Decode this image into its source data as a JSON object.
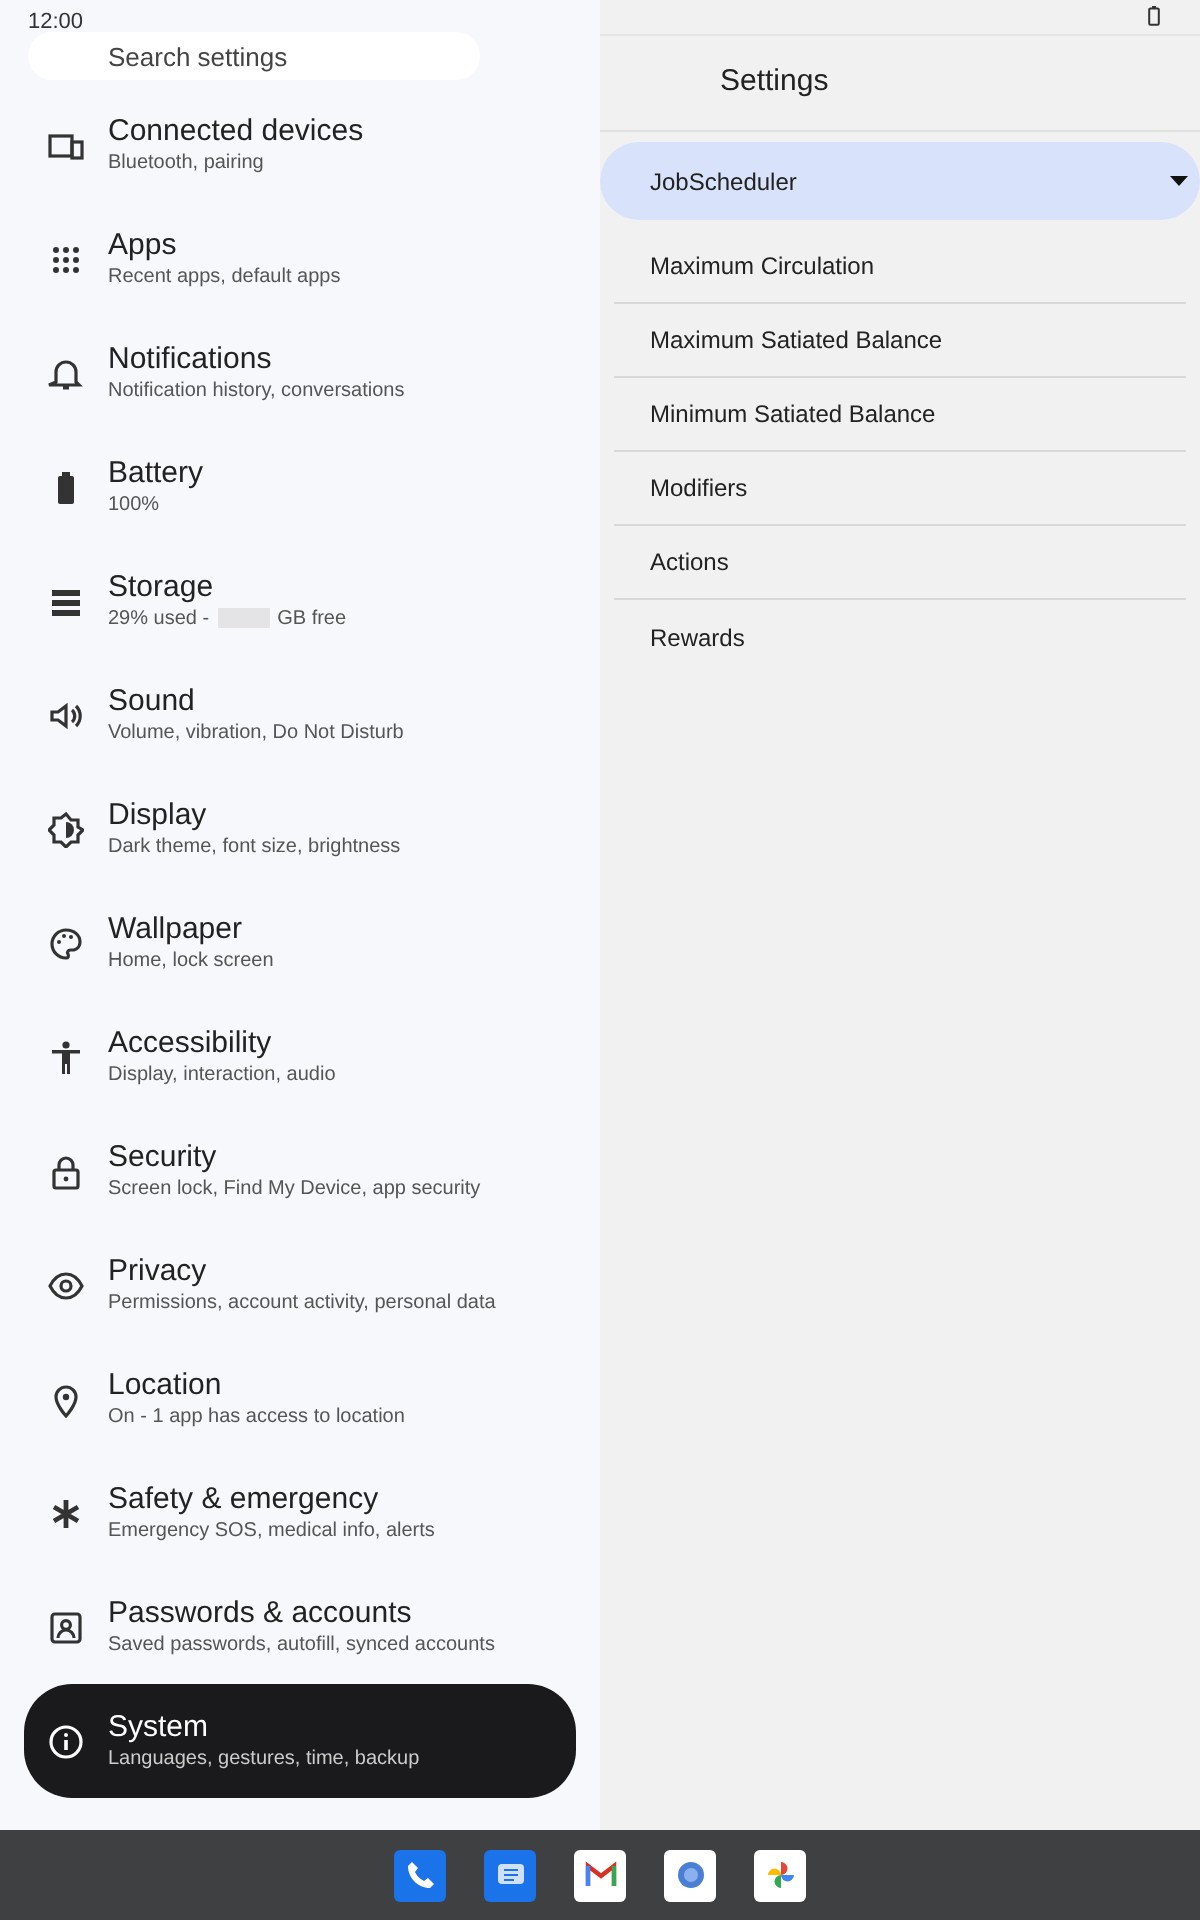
{
  "status_bar": {
    "time": "12:00"
  },
  "search": {
    "placeholder": "Search settings"
  },
  "sidebar": {
    "items": [
      {
        "title": "Connected devices",
        "subtitle": "Bluetooth, pairing",
        "selected": false
      },
      {
        "title": "Apps",
        "subtitle": "Recent apps, default apps",
        "selected": false
      },
      {
        "title": "Notifications",
        "subtitle": "Notification history, conversations",
        "selected": false
      },
      {
        "title": "Battery",
        "subtitle": "100%",
        "selected": false
      },
      {
        "title": "Storage",
        "subtitle": "29% used -",
        "redacted": true,
        "subtitle_end": "GB free",
        "selected": false
      },
      {
        "title": "Sound",
        "subtitle": "Volume, vibration, Do Not Disturb",
        "selected": false
      },
      {
        "title": "Display",
        "subtitle": "Dark theme, font size, brightness",
        "selected": false
      },
      {
        "title": "Wallpaper",
        "subtitle": "Home, lock screen",
        "selected": false
      },
      {
        "title": "Accessibility",
        "subtitle": "Display, interaction, audio",
        "selected": false
      },
      {
        "title": "Security",
        "subtitle": "Screen lock, Find My Device, app security",
        "selected": false
      },
      {
        "title": "Privacy",
        "subtitle": "Permissions, account activity, personal data",
        "selected": false
      },
      {
        "title": "Location",
        "subtitle": "On - 1 app has access to location",
        "selected": false
      },
      {
        "title": "Safety & emergency",
        "subtitle": "Emergency SOS, medical info, alerts",
        "selected": false
      },
      {
        "title": "Passwords & accounts",
        "subtitle": "Saved passwords, autofill, synced accounts",
        "selected": false
      },
      {
        "title": "System",
        "subtitle": "Languages, gestures, time, backup",
        "selected": true
      }
    ]
  },
  "detail": {
    "title": "Settings",
    "dropdown": {
      "value": "JobScheduler"
    },
    "items": [
      "Maximum Circulation",
      "Maximum Satiated Balance",
      "Minimum Satiated Balance",
      "Modifiers",
      "Actions",
      "Rewards"
    ]
  },
  "taskbar": {
    "apps": [
      {
        "kind": "phone"
      },
      {
        "kind": "messages"
      },
      {
        "kind": "mail"
      },
      {
        "kind": "browser"
      },
      {
        "kind": "photos"
      }
    ]
  }
}
